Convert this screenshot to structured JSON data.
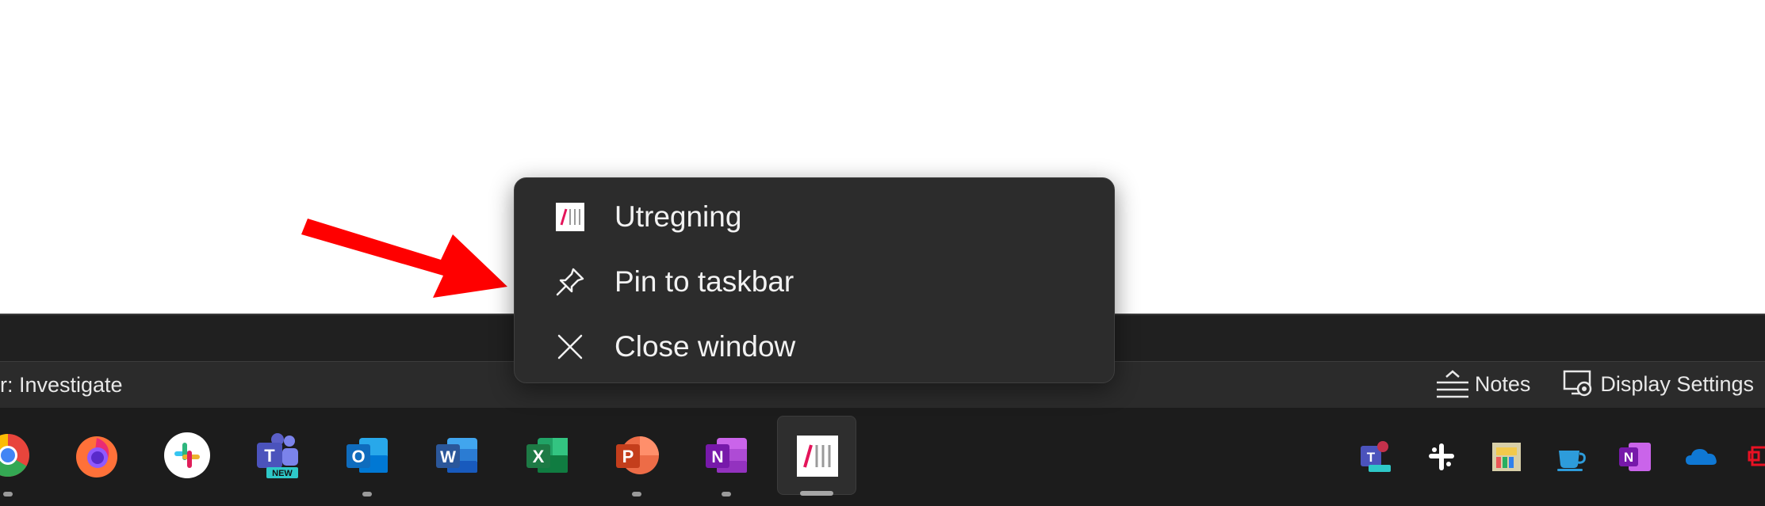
{
  "status_bar": {
    "left_text": "r: Investigate",
    "notes_label": "Notes",
    "display_settings_label": "Display Settings"
  },
  "context_menu": {
    "items": [
      {
        "label": "Utregning",
        "icon": "utregning-app-icon"
      },
      {
        "label": "Pin to taskbar",
        "icon": "pin-icon"
      },
      {
        "label": "Close window",
        "icon": "close-icon"
      }
    ]
  },
  "taskbar": {
    "apps": [
      {
        "name": "chrome",
        "running": true
      },
      {
        "name": "firefox",
        "running": false
      },
      {
        "name": "slack",
        "running": false
      },
      {
        "name": "teams-new",
        "badge": "NEW",
        "running": false
      },
      {
        "name": "outlook",
        "letter": "O",
        "running": true
      },
      {
        "name": "word",
        "letter": "W",
        "running": false
      },
      {
        "name": "excel",
        "letter": "X",
        "running": false
      },
      {
        "name": "powerpoint",
        "letter": "P",
        "running": true
      },
      {
        "name": "onenote",
        "letter": "N",
        "running": true
      },
      {
        "name": "utregning",
        "running": true,
        "active": true
      }
    ],
    "tray": [
      {
        "name": "teams-tray"
      },
      {
        "name": "slack-tray"
      },
      {
        "name": "app-tray"
      },
      {
        "name": "coffee-tray"
      },
      {
        "name": "onenote-tray",
        "letter": "N"
      },
      {
        "name": "onedrive-tray"
      },
      {
        "name": "network-tray"
      }
    ]
  },
  "colors": {
    "taskbar_bg": "#1c1c1c",
    "menu_bg": "#2c2c2c",
    "arrow": "#ff0000",
    "word": "#2b579a",
    "excel": "#1d7a45",
    "powerpoint": "#d24726",
    "onenote": "#7719aa",
    "outlook": "#0f6cbd"
  }
}
